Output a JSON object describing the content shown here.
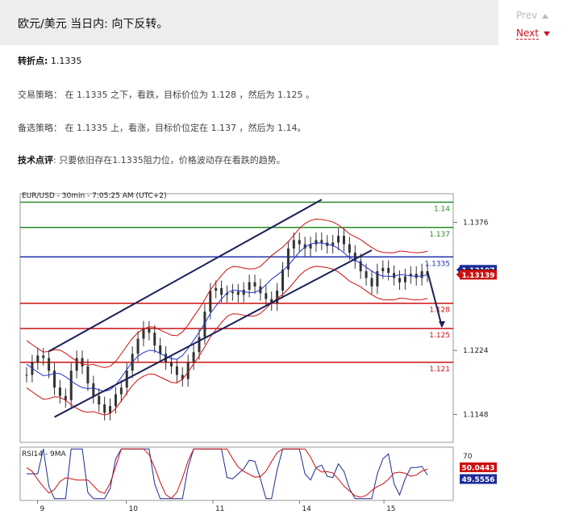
{
  "header": {
    "title": "欧元/美元 当日内: 向下反转。"
  },
  "nav": {
    "prev": "Prev",
    "next": "Next"
  },
  "article": {
    "pivot_label": "转折点:",
    "pivot_value": "1.1335",
    "strategy_label": "交易策略：",
    "strategy_text": "在 1.1335 之下，看跌，目标价位为 1.128 ，然后为 1.125 。",
    "alt_label": "备选策略：",
    "alt_text": "在 1.1335 上，看涨，目标价位定在 1.137 ，然后为 1.14。",
    "comment_label": "技术点评",
    "comment_text": ": 只要依旧存在1.1335阻力位，价格波动存在看跌的趋势。"
  },
  "chart_data": {
    "type": "line",
    "title": "EUR/USD - 30min - 7:05:25 AM (UTC+2)",
    "ylim": [
      1.1115,
      1.141
    ],
    "x_ticks": [
      "9",
      "10",
      "11",
      "14",
      "15"
    ],
    "y_ticks": [
      1.1376,
      1.1224,
      1.1148
    ],
    "y_tick_labels": [
      "1.1376",
      "1.1224",
      "1.1148"
    ],
    "series": [
      {
        "type": "candles",
        "values": [
          1.1195,
          1.121,
          1.1218,
          1.1215,
          1.12,
          1.118,
          1.117,
          1.1165,
          1.12,
          1.1215,
          1.1205,
          1.1185,
          1.117,
          1.116,
          1.115,
          1.1158,
          1.1172,
          1.118,
          1.12,
          1.122,
          1.1238,
          1.125,
          1.1245,
          1.123,
          1.122,
          1.121,
          1.1205,
          1.1195,
          1.119,
          1.121,
          1.1222,
          1.124,
          1.127,
          1.1295,
          1.1298,
          1.129,
          1.1292,
          1.1294,
          1.129,
          1.1296,
          1.1305,
          1.13,
          1.1292,
          1.1285,
          1.128,
          1.1295,
          1.132,
          1.1345,
          1.1355,
          1.135,
          1.1345,
          1.135,
          1.1355,
          1.1352,
          1.1348,
          1.1352,
          1.136,
          1.135,
          1.134,
          1.133,
          1.1318,
          1.131,
          1.13,
          1.1318,
          1.1322,
          1.1316,
          1.131,
          1.1305,
          1.1312,
          1.1315,
          1.131,
          1.1318,
          1.1314
        ]
      }
    ],
    "levels": [
      {
        "label": "1.14",
        "value": 1.14,
        "color": "#2a8a2a"
      },
      {
        "label": "1.137",
        "value": 1.137,
        "color": "#2a8a2a"
      },
      {
        "label": "1.1335",
        "value": 1.1335,
        "color": "#2233aa"
      },
      {
        "label": "1.128",
        "value": 1.128,
        "color": "#cc1111"
      },
      {
        "label": "1.125",
        "value": 1.125,
        "color": "#cc1111"
      },
      {
        "label": "1.121",
        "value": 1.121,
        "color": "#cc1111"
      }
    ],
    "price_badges": [
      {
        "label": "1.13197",
        "value": 1.13197,
        "color": "#1a2a9a"
      },
      {
        "label": "1.13144",
        "value": 1.13144,
        "color": "#111111"
      },
      {
        "label": "1.13139",
        "value": 1.13139,
        "color": "#cc1111"
      }
    ],
    "rsi": {
      "title": "RSI14 - 9MA",
      "tick": "70",
      "ylim": [
        20,
        80
      ],
      "badges": [
        {
          "label": "50.0443",
          "value": 50.0443,
          "color": "#cc1111"
        },
        {
          "label": "49.5556",
          "value": 49.5556,
          "color": "#1a2a9a"
        }
      ]
    }
  }
}
